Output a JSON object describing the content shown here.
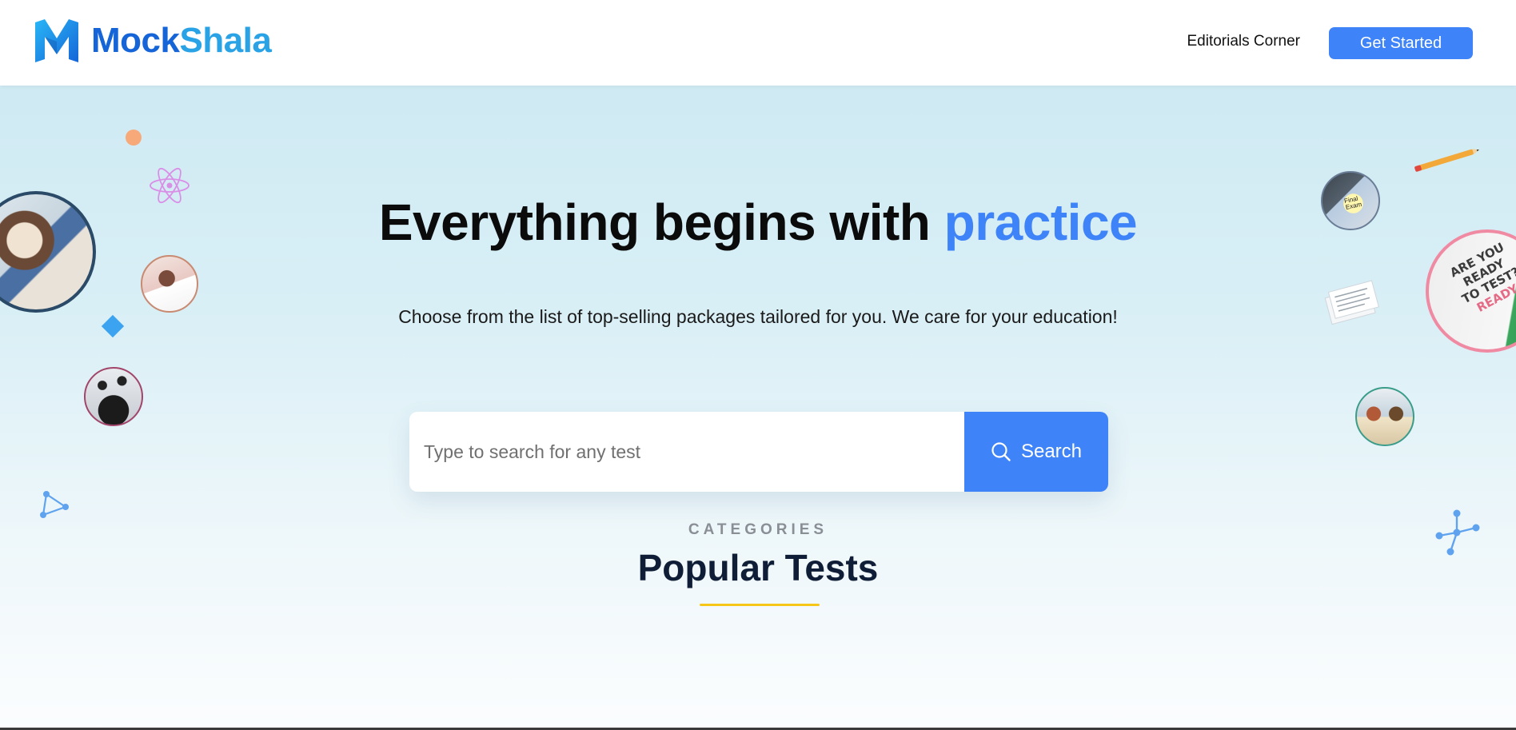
{
  "brand": {
    "name_part1": "Mock",
    "name_part2": "Shala"
  },
  "nav": {
    "editorials_label": "Editorials Corner",
    "get_started_label": "Get Started"
  },
  "hero": {
    "headline_main": "Everything begins with ",
    "headline_accent": "practice",
    "subheadline": "Choose from the list of top-selling packages tailored for you. We care for your education!"
  },
  "search": {
    "placeholder": "Type to search for any test",
    "button_label": "Search",
    "icon": "search-icon"
  },
  "categories": {
    "eyebrow": "CATEGORIES",
    "title": "Popular Tests"
  },
  "decor": {
    "note_circle_text": [
      "ARE YOU",
      "READY",
      "TO TEST?",
      "READY"
    ],
    "note_small_text": [
      "Final",
      "Exam"
    ]
  },
  "colors": {
    "primary": "#3f83f8",
    "brand_dark": "#1565d8",
    "brand_light": "#29a3e6",
    "underline": "#f6c619",
    "headline": "#0b0b0b",
    "section_title": "#0f1e36"
  }
}
